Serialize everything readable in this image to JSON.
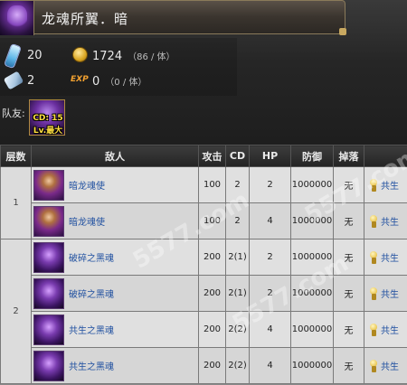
{
  "stage": {
    "title": "龙魂所翼．暗"
  },
  "stats": {
    "stamina": "20",
    "coin": "1724",
    "coin_rate": "（86 / 体）",
    "potion": "2",
    "exp_label": "EXP",
    "exp": "0",
    "exp_rate": "（0 / 体）"
  },
  "team": {
    "label": "队友:",
    "cd": "CD: 15",
    "lv": "Lv.最大"
  },
  "table": {
    "headers": [
      "层数",
      "敌人",
      "攻击",
      "CD",
      "HP",
      "防御",
      "掉落"
    ],
    "floors": [
      {
        "floor": "1",
        "rows": [
          {
            "name": "暗龙魂使",
            "atk": "100",
            "cd": "2",
            "hp": "2",
            "def": "1000000",
            "drop": "无",
            "share": "共生"
          },
          {
            "name": "暗龙魂使",
            "atk": "100",
            "cd": "2",
            "hp": "4",
            "def": "1000000",
            "drop": "无",
            "share": "共生"
          }
        ]
      },
      {
        "floor": "2",
        "rows": [
          {
            "name": "破碎之黑魂",
            "atk": "200",
            "cd": "2(1)",
            "hp": "2",
            "def": "1000000",
            "drop": "无",
            "share": "共生"
          },
          {
            "name": "破碎之黑魂",
            "atk": "200",
            "cd": "2(1)",
            "hp": "2",
            "def": "1000000",
            "drop": "无",
            "share": "共生"
          },
          {
            "name": "共生之黑魂",
            "atk": "200",
            "cd": "2(2)",
            "hp": "4",
            "def": "1000000",
            "drop": "无",
            "share": "共生"
          },
          {
            "name": "共生之黑魂",
            "atk": "200",
            "cd": "2(2)",
            "hp": "4",
            "def": "1000000",
            "drop": "无",
            "share": "共生"
          }
        ]
      }
    ]
  },
  "watermark": [
    "5577.com",
    "5577.com",
    "5577.com"
  ],
  "colors": {
    "link": "#2050a0",
    "header_bg": "#242424",
    "gold": "#ffe040"
  }
}
